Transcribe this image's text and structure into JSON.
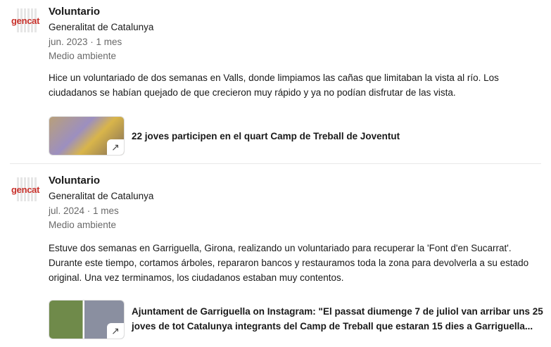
{
  "entries": [
    {
      "title": "Voluntario",
      "org": "Generalitat de Catalunya",
      "date": "jun. 2023 · 1 mes",
      "category": "Medio ambiente",
      "logo": "gencat",
      "description": "Hice un voluntariado de dos semanas en Valls, donde limpiamos las cañas que limitaban la vista al río. Los ciudadanos se habían quejado de que crecieron muy rápido y ya no podían disfrutar de las vista.",
      "media_title": "22 joves participen en el quart Camp de Treball de Joventut"
    },
    {
      "title": "Voluntario",
      "org": "Generalitat de Catalunya",
      "date": "jul. 2024 · 1 mes",
      "category": "Medio ambiente",
      "logo": "gencat",
      "description": "Estuve dos semanas en Garriguella, Girona, realizando un voluntariado para recuperar la 'Font d'en Sucarrat'. Durante este tiempo, cortamos árboles, repararon bancos y restauramos toda la zona para devolverla a su estado original. Una vez terminamos, los ciudadanos estaban muy contentos.",
      "media_title": "Ajuntament de Garriguella on Instagram: \"El passat diumenge 7 de juliol van arribar uns 25 joves de tot Catalunya integrants del Camp de Treball que estaran 15 dies a Garriguella..."
    }
  ]
}
